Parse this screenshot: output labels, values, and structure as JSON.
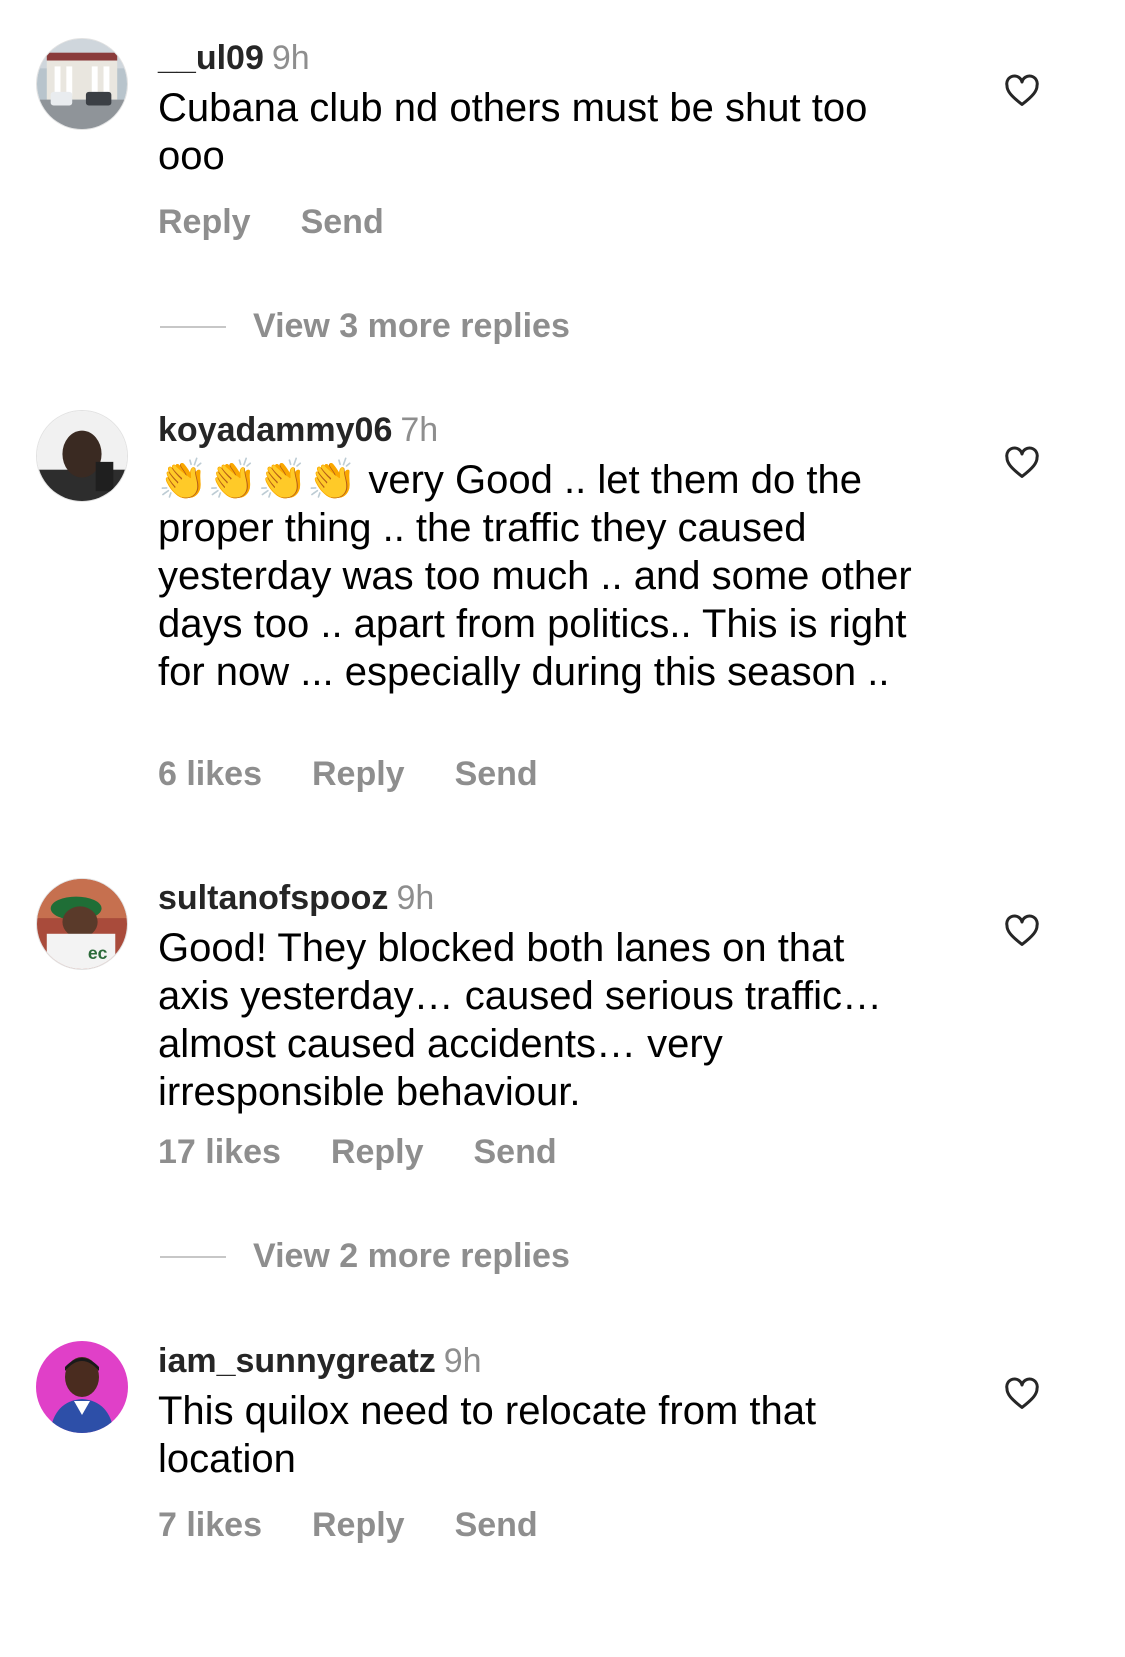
{
  "comments": [
    {
      "username": "__ul09",
      "time": "9h",
      "text": "Cubana club nd others must be shut too ooo",
      "reply_label": "Reply",
      "send_label": "Send",
      "avatar_icon": "building-photo",
      "view_more": "View 3 more replies"
    },
    {
      "username": "koyadammy06",
      "time": "7h",
      "emoji": "👏👏👏👏",
      "text": "very Good .. let them do the proper thing .. the traffic they caused yesterday was too much .. and some other days too .. apart from politics.. This is right for now ... especially during this season ..",
      "likes": "6 likes",
      "reply_label": "Reply",
      "send_label": "Send",
      "avatar_icon": "man-portrait"
    },
    {
      "username": "sultanofspooz",
      "time": "9h",
      "text": "Good! They blocked both lanes on that axis yesterday… caused serious traffic… almost caused accidents… very irresponsible behaviour.",
      "likes": "17 likes",
      "reply_label": "Reply",
      "send_label": "Send",
      "avatar_icon": "man-green-cap",
      "view_more": "View 2 more replies"
    },
    {
      "username": "iam_sunnygreatz",
      "time": "9h",
      "text": "This quilox need to relocate from that location",
      "likes": "7 likes",
      "reply_label": "Reply",
      "send_label": "Send",
      "avatar_icon": "man-magenta-background"
    }
  ],
  "colors": {
    "muted": "#8e8e8e",
    "username": "#262626",
    "divider": "#c7c7c7",
    "avatar4_bg": "#e040c8"
  },
  "icons": {
    "like": "heart-outline-icon"
  }
}
